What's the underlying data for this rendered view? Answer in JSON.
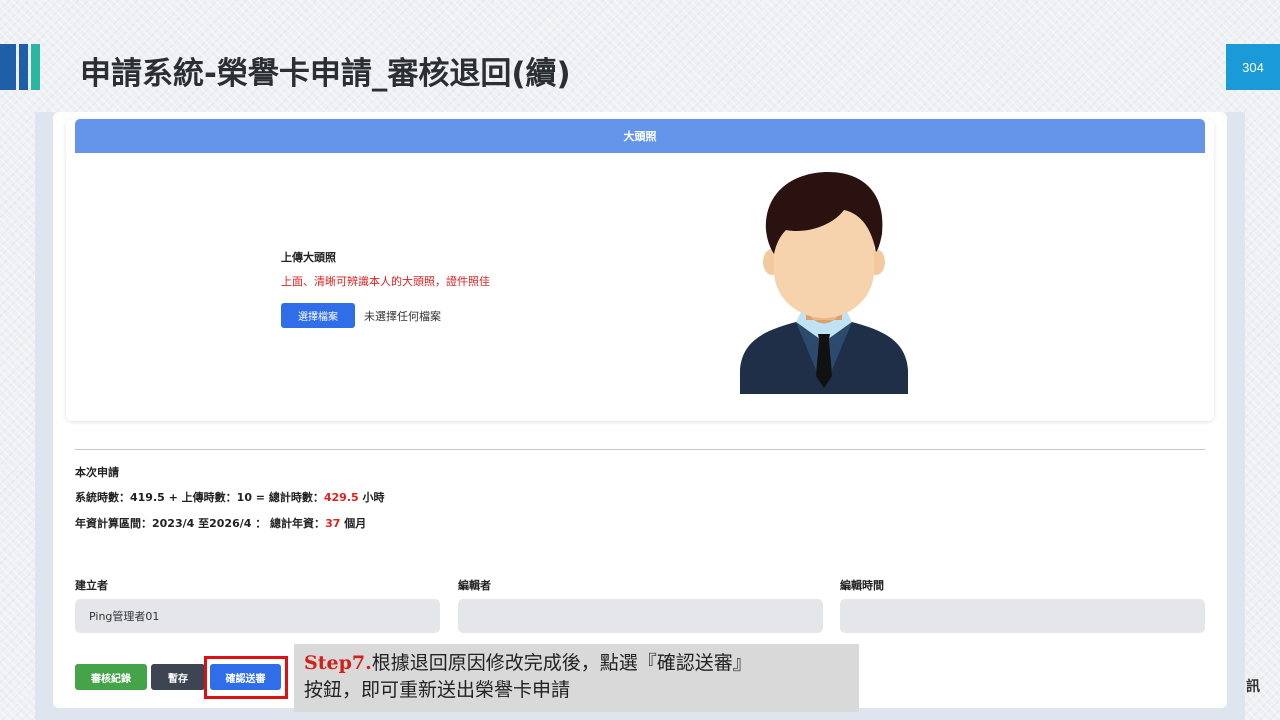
{
  "header": {
    "title": "申請系統-榮譽卡申請_審核退回(續)",
    "page_number": "304",
    "accent_colors": [
      "#1f5fa8",
      "#2bb6a3",
      "#1a9ad6"
    ]
  },
  "photo_section": {
    "header": "大頭照",
    "upload_label": "上傳大頭照",
    "upload_hint": "上面、清晰可辨識本人的大頭照，證件照佳",
    "choose_file_button": "選擇檔案",
    "no_file_text": "未選擇任何檔案",
    "avatar_icon": "person-avatar-icon"
  },
  "summary": {
    "title": "本次申請",
    "hours_prefix": "系統時數：419.5 + 上傳時數：10 = 總計時數：",
    "hours_total": "429.5",
    "hours_suffix": " 小時",
    "seniority_prefix": "年資計算區間：2023/4 至2026/4 ： 總計年資：",
    "seniority_total": "37",
    "seniority_suffix": " 個月"
  },
  "fields": {
    "creator_label": "建立者",
    "creator_value": "Ping管理者01",
    "editor_label": "編輯者",
    "editor_value": "",
    "edit_time_label": "編輯時間",
    "edit_time_value": ""
  },
  "buttons": {
    "history": "審核紀錄",
    "save": "暫存",
    "submit": "確認送審"
  },
  "callout": {
    "step": "Step7.",
    "line1": "根據退回原因修改完成後，點選『確認送審』",
    "line2": "按鈕，即可重新送出榮譽卡申請"
  },
  "corner_mark": "訊"
}
